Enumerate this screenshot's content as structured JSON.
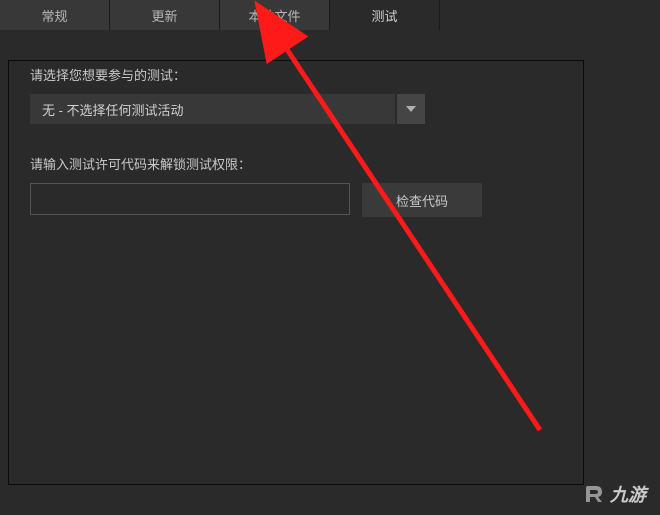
{
  "tabs": {
    "general": "常规",
    "updates": "更新",
    "local_files": "本地文件",
    "betas": "测试"
  },
  "beta": {
    "select_label": "请选择您想要参与的测试：",
    "selected_option": "无 - 不选择任何测试活动",
    "code_label": "请输入测试许可代码来解锁测试权限：",
    "code_value": "",
    "check_button": "检查代码"
  },
  "watermark": {
    "text": "九游"
  }
}
